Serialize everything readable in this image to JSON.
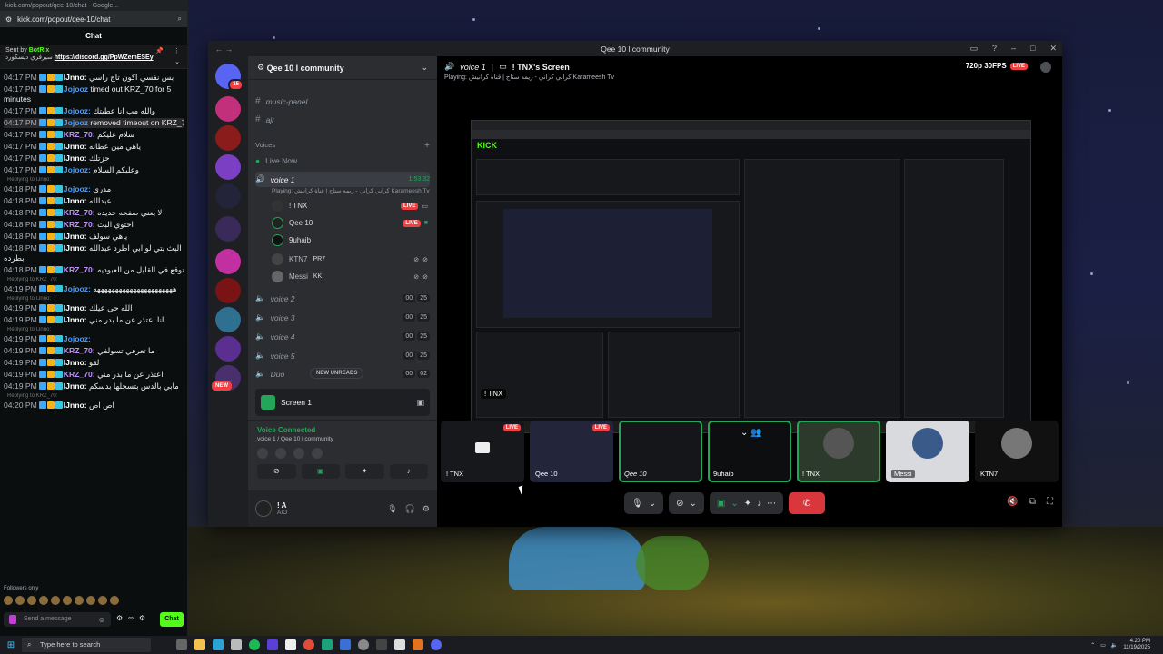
{
  "chat_window": {
    "title_bar": "kick.com/popout/qee-10/chat - Google...",
    "url": "kick.com/popout/qee-10/chat",
    "header": "Chat",
    "pinned": {
      "sent_by": "Sent by",
      "bot_name": "BotRix",
      "text": "سيرفري ديسكورد",
      "link": "https://discord.gg/PpWZemESEy"
    },
    "messages": [
      {
        "time": "04:17 PM",
        "user": "IJnno:",
        "text": "بس نفسي اكون تاج راسي",
        "cls": "u3"
      },
      {
        "time": "04:17 PM",
        "user": "Jojooz",
        "text": "timed out KRZ_70 for 5 minutes",
        "cls": "u1",
        "wrap": true
      },
      {
        "time": "04:17 PM",
        "user": "Jojooz:",
        "text": "والله مب انا عطيتك",
        "cls": "u1"
      },
      {
        "time": "04:17 PM",
        "user": "Jojooz",
        "text": "removed timeout on KRZ_70",
        "cls": "u1",
        "hl": true
      },
      {
        "time": "04:17 PM",
        "user": "KRZ_70:",
        "text": "سلام عليكم",
        "cls": "u2"
      },
      {
        "time": "04:17 PM",
        "user": "IJnno:",
        "text": "ياهي مين عطانه",
        "cls": "u3"
      },
      {
        "time": "04:17 PM",
        "user": "IJnno:",
        "text": "حزتلك",
        "cls": "u3"
      },
      {
        "time": "04:17 PM",
        "user": "Jojooz:",
        "text": "وعليكم السلام",
        "cls": "u1"
      },
      {
        "time": "04:18 PM",
        "user": "Jojooz:",
        "text": "مدري",
        "cls": "u1",
        "reply": "Replying to IJnno:"
      },
      {
        "time": "04:18 PM",
        "user": "IJnno:",
        "text": "عبدالله",
        "cls": "u3"
      },
      {
        "time": "04:18 PM",
        "user": "KRZ_70:",
        "text": "لا يعني صفحه جديده",
        "cls": "u2"
      },
      {
        "time": "04:18 PM",
        "user": "KRZ_70:",
        "text": "احتوي البث",
        "cls": "u2"
      },
      {
        "time": "04:18 PM",
        "user": "IJnno:",
        "text": "ياهي سولف",
        "cls": "u3"
      },
      {
        "time": "04:18 PM",
        "user": "IJnno:",
        "text": "البث بتي لو ابي اطرد عبدالله بطرده",
        "cls": "u3",
        "wrap": true
      },
      {
        "time": "04:18 PM",
        "user": "KRZ_70:",
        "text": "اتوقع في القليل من العبوديه",
        "cls": "u2"
      },
      {
        "time": "04:19 PM",
        "user": "Jojooz:",
        "text": "ههههههههههههههههههههههه",
        "cls": "u1",
        "reply": "Replying to KRZ_70:"
      },
      {
        "time": "04:19 PM",
        "user": "IJnno:",
        "text": "الله حي عيلك",
        "cls": "u3",
        "reply": "Replying to IJnno:"
      },
      {
        "time": "04:19 PM",
        "user": "IJnno:",
        "text": "انا اعتذر عن ما بدر مني",
        "cls": "u3"
      },
      {
        "time": "04:19 PM",
        "user": "Jojooz:",
        "text": "",
        "cls": "u1",
        "reply": "Replying to IJnno:"
      },
      {
        "time": "04:19 PM",
        "user": "KRZ_70:",
        "text": "ما تعرفي تسولفي",
        "cls": "u2"
      },
      {
        "time": "04:19 PM",
        "user": "IJnno:",
        "text": "لقو",
        "cls": "u3"
      },
      {
        "time": "04:19 PM",
        "user": "KRZ_70:",
        "text": "اعتذر عن ما بدر مني",
        "cls": "u2"
      },
      {
        "time": "04:19 PM",
        "user": "IJnno:",
        "text": "مابي بالدس بتسجلها بدسكم",
        "cls": "u3",
        "wrap": true
      },
      {
        "time": "04:20 PM",
        "user": "IJnno:",
        "text": "اص اص",
        "cls": "u3",
        "reply": "Replying to KRZ_70:"
      }
    ],
    "followers_only": "Followers only",
    "input_placeholder": "Send a message",
    "chat_button": "Chat"
  },
  "discord": {
    "window_title": "Qee 10 l community",
    "server_name": "Qee 10 l community",
    "server_badge": "15",
    "new_badge": "NEW",
    "channels": {
      "music_panel": "music-panel",
      "ajr": "ajr",
      "voices_category": "Voices",
      "live_now": "Live Now",
      "voice1": "voice 1",
      "voice1_time": "1:53:32",
      "voice1_activity": "Playing: كراني كراني - ريمه ستاج | قناة كرانيش Karameesh Tv",
      "users": [
        {
          "name": "! TNX",
          "live": "LIVE"
        },
        {
          "name": "Qee 10",
          "live": "LIVE"
        },
        {
          "name": "9uhaib",
          "live": ""
        },
        {
          "name": "KTN7",
          "extra": "PR7",
          "live": ""
        },
        {
          "name": "Messi",
          "extra": "KK",
          "live": ""
        }
      ],
      "voice2": "voice 2",
      "voice3": "voice 3",
      "voice4": "voice 4",
      "voice5": "voice 5",
      "duo": "Duo",
      "count_a": "00",
      "count_b": "25",
      "count_duo": "02",
      "new_unreads": "NEW UNREADS"
    },
    "stream_card": "Screen 1",
    "voice_connected": "Voice Connected",
    "voice_location": "voice 1 / Qee 10 l community",
    "user_name": "! A",
    "user_sub": "AIO",
    "stage": {
      "channel": "voice 1",
      "streamer": "! TNX's Screen",
      "activity": "Playing: كراني كراني - ريمه ستاج | قناة كرانيش Karameesh Tv",
      "quality": "720p 30FPS",
      "live": "LIVE",
      "stream_label": "! TNX"
    },
    "tiles": [
      {
        "label": "! TNX",
        "live": "LIVE"
      },
      {
        "label": "Qee 10",
        "live": "LIVE"
      },
      {
        "label": "Qee 10",
        "live": ""
      },
      {
        "label": "9uhaib",
        "live": ""
      },
      {
        "label": "! TNX",
        "live": ""
      },
      {
        "label": "Messi",
        "live": ""
      },
      {
        "label": "KTN7",
        "live": ""
      }
    ]
  },
  "taskbar": {
    "search_placeholder": "Type here to search",
    "time": "4:20 PM",
    "date": "11/19/2025"
  }
}
